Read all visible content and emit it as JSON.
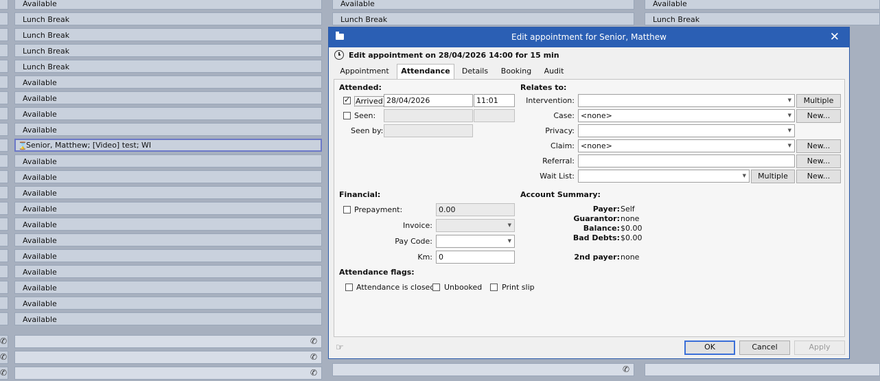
{
  "schedule": {
    "left_column": [
      "Available",
      "Lunch Break",
      "Lunch Break",
      "Lunch Break",
      "Lunch Break",
      "Available",
      "Available",
      "Available",
      "Available",
      "",
      "Available",
      "Available",
      "Available",
      "Available",
      "Available",
      "Available",
      "Available",
      "Available",
      "Available",
      "Available",
      "Available"
    ],
    "appointment_slot": "Senior, Matthew; [Video] test; WI",
    "middle_column": [
      "Available",
      "Lunch Break"
    ],
    "right_column": [
      "Available",
      "Lunch Break"
    ]
  },
  "dialog": {
    "title": "Edit appointment for Senior, Matthew",
    "header": "Edit appointment on 28/04/2026 14:00 for 15 min",
    "tabs": [
      "Appointment",
      "Attendance",
      "Details",
      "Booking",
      "Audit"
    ],
    "active_tab": "Attendance",
    "attended": {
      "section": "Attended:",
      "arrived_label": "Arrived:",
      "arrived_checked": true,
      "arrived_date": "28/04/2026",
      "arrived_time": "11:01",
      "seen_label": "Seen:",
      "seen_checked": false,
      "seen_by_label": "Seen by:"
    },
    "relates": {
      "section": "Relates to:",
      "intervention_label": "Intervention:",
      "intervention_value": "",
      "case_label": "Case:",
      "case_value": "<none>",
      "privacy_label": "Privacy:",
      "privacy_value": "",
      "claim_label": "Claim:",
      "claim_value": "<none>",
      "referral_label": "Referral:",
      "referral_value": "",
      "waitlist_label": "Wait List:",
      "waitlist_value": "",
      "multiple_label": "Multiple",
      "new_label": "New..."
    },
    "financial": {
      "section": "Financial:",
      "prepayment_label": "Prepayment:",
      "prepayment_value": "0.00",
      "invoice_label": "Invoice:",
      "paycode_label": "Pay Code:",
      "km_label": "Km:",
      "km_value": "0"
    },
    "account": {
      "section": "Account Summary:",
      "payer_label": "Payer:",
      "payer_value": "Self",
      "guarantor_label": "Guarantor:",
      "guarantor_value": "none",
      "balance_label": "Balance:",
      "balance_value": "$0.00",
      "bad_debts_label": "Bad Debts:",
      "bad_debts_value": "$0.00",
      "second_payer_label": "2nd payer:",
      "second_payer_value": "none"
    },
    "flags": {
      "section": "Attendance flags:",
      "closed_label": "Attendance is closed",
      "unbooked_label": "Unbooked",
      "print_slip_label": "Print slip"
    },
    "buttons": {
      "ok": "OK",
      "cancel": "Cancel",
      "apply": "Apply"
    }
  },
  "colors": {
    "titlebar": "#2b5fb4",
    "slot": "#c9d1dd",
    "appt_border": "#6c78c8"
  },
  "icons": [
    "folder-icon",
    "close-icon",
    "clock-icon",
    "hourglass-icon",
    "phone-icon",
    "hand-icon",
    "checkmark-icon",
    "dropdown-arrow-icon"
  ]
}
